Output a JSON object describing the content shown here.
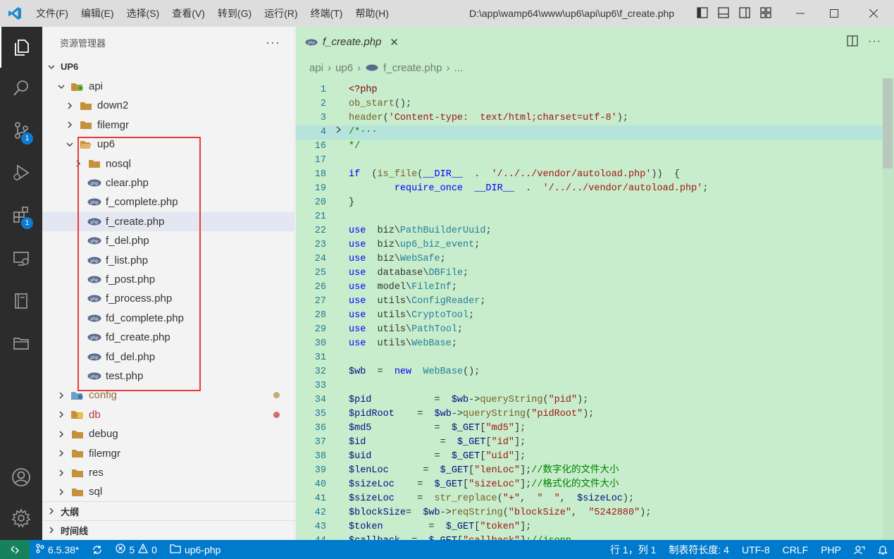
{
  "menu": [
    "文件(F)",
    "编辑(E)",
    "选择(S)",
    "查看(V)",
    "转到(G)",
    "运行(R)",
    "终端(T)",
    "帮助(H)"
  ],
  "window_title": "D:\\app\\wamp64\\www\\up6\\api\\up6\\f_create.php",
  "activity_badges": {
    "scm": "1",
    "extensions": "1"
  },
  "sidebar": {
    "title": "资源管理器",
    "more": "···",
    "root": "UP6",
    "items": [
      {
        "label": "api",
        "color": "#333333"
      },
      {
        "label": "down2",
        "color": "#333333"
      },
      {
        "label": "filemgr",
        "color": "#333333"
      },
      {
        "label": "up6",
        "color": "#333333"
      },
      {
        "label": "nosql",
        "color": "#333333"
      },
      {
        "label": "clear.php",
        "color": "#333333"
      },
      {
        "label": "f_complete.php",
        "color": "#333333"
      },
      {
        "label": "f_create.php",
        "color": "#333333"
      },
      {
        "label": "f_del.php",
        "color": "#333333"
      },
      {
        "label": "f_list.php",
        "color": "#333333"
      },
      {
        "label": "f_post.php",
        "color": "#333333"
      },
      {
        "label": "f_process.php",
        "color": "#333333"
      },
      {
        "label": "fd_complete.php",
        "color": "#333333"
      },
      {
        "label": "fd_create.php",
        "color": "#333333"
      },
      {
        "label": "fd_del.php",
        "color": "#333333"
      },
      {
        "label": "test.php",
        "color": "#333333"
      },
      {
        "label": "config",
        "color": "#8c6c3e"
      },
      {
        "label": "db",
        "color": "#b03a3a"
      },
      {
        "label": "debug",
        "color": "#333333"
      },
      {
        "label": "filemgr",
        "color": "#333333"
      },
      {
        "label": "res",
        "color": "#333333"
      },
      {
        "label": "sql",
        "color": "#333333"
      }
    ],
    "panels": [
      "大纲",
      "时间线"
    ]
  },
  "editor": {
    "tab_label": "f_create.php",
    "breadcrumb": [
      "api",
      "up6",
      "f_create.php",
      "..."
    ],
    "line_numbers": [
      "1",
      "2",
      "3",
      "4",
      "16",
      "17",
      "18",
      "19",
      "20",
      "21",
      "22",
      "23",
      "24",
      "25",
      "26",
      "27",
      "28",
      "29",
      "30",
      "31",
      "32",
      "33",
      "34",
      "35",
      "36",
      "37",
      "38",
      "39",
      "40",
      "41",
      "42",
      "43",
      "44"
    ]
  },
  "statusbar": {
    "branch": "6.5.38*",
    "errors": "5",
    "warnings": "0",
    "folder": "up6-php",
    "position": "行 1，列 1",
    "tab_size": "制表符长度: 4",
    "encoding": "UTF-8",
    "eol": "CRLF",
    "language": "PHP"
  },
  "colors": {
    "statusbar": "#007acc",
    "editor_bg": "#c7edcc",
    "activity": "#2c2c2c",
    "highlight": "#e53b3b"
  }
}
